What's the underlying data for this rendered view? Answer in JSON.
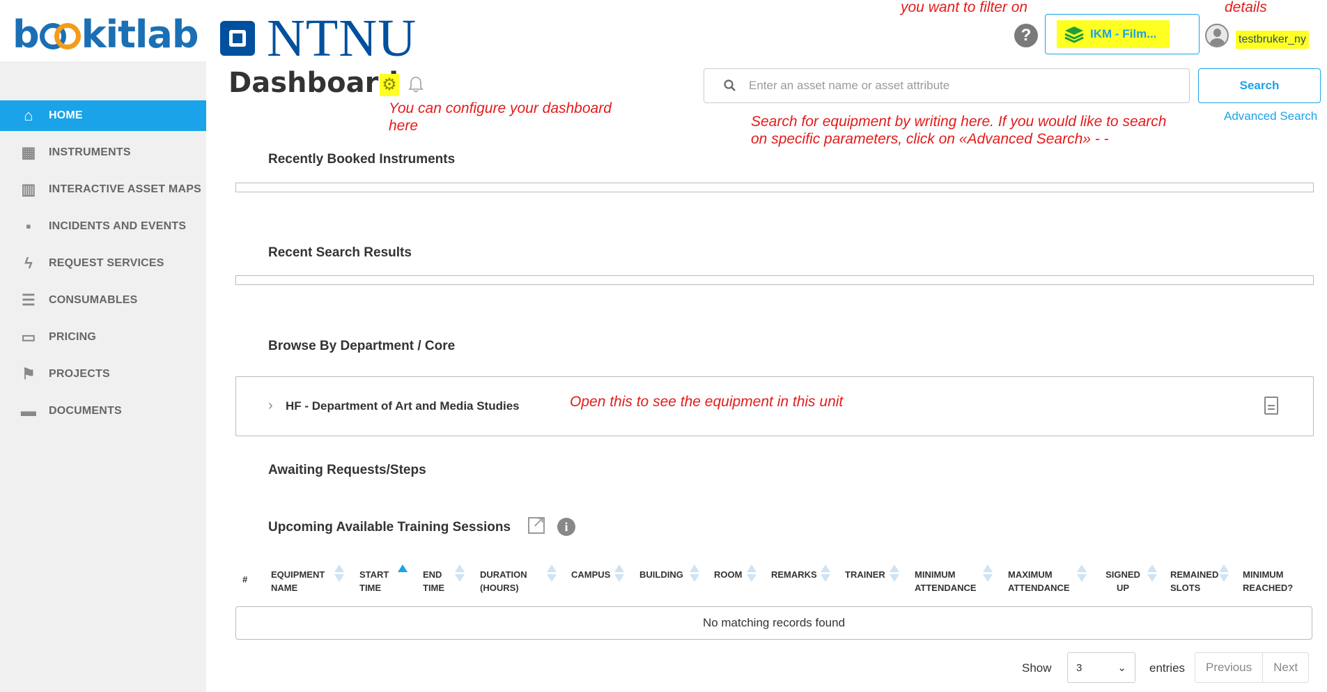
{
  "logo": {
    "text": "bookitlab"
  },
  "org": {
    "name": "NTNU"
  },
  "sidebar": {
    "items": [
      {
        "label": "HOME",
        "icon": "home-icon",
        "active": true
      },
      {
        "label": "INSTRUMENTS",
        "icon": "calendar-icon"
      },
      {
        "label": "INTERACTIVE ASSET MAPS",
        "icon": "map-icon"
      },
      {
        "label": "INCIDENTS AND EVENTS",
        "icon": "chat-icon"
      },
      {
        "label": "REQUEST SERVICES",
        "icon": "bolt-icon"
      },
      {
        "label": "CONSUMABLES",
        "icon": "list-icon"
      },
      {
        "label": "PRICING",
        "icon": "money-icon"
      },
      {
        "label": "PROJECTS",
        "icon": "flag-icon"
      },
      {
        "label": "DOCUMENTS",
        "icon": "folder-icon"
      }
    ]
  },
  "header": {
    "filter_label": "IKM - Film...",
    "user_name": "testbruker_ny"
  },
  "page": {
    "title": "Dashboard"
  },
  "search": {
    "placeholder": "Enter an asset name or asset attribute",
    "button": "Search",
    "advanced": "Advanced Search"
  },
  "sections": {
    "recently_booked": "Recently Booked Instruments",
    "recent_search": "Recent Search Results",
    "browse": "Browse By Department / Core",
    "awaiting": "Awaiting Requests/Steps",
    "training": "Upcoming Available Training Sessions"
  },
  "department": {
    "label": "HF - Department of Art and Media Studies"
  },
  "table": {
    "columns": [
      "#",
      "EQUIPMENT NAME",
      "START TIME",
      "END TIME",
      "DURATION (HOURS)",
      "CAMPUS",
      "BUILDING",
      "ROOM",
      "REMARKS",
      "TRAINER",
      "MINIMUM ATTENDANCE",
      "MAXIMUM ATTENDANCE",
      "SIGNED UP",
      "REMAINED SLOTS",
      "MINIMUM REACHED?"
    ],
    "empty": "No matching records found"
  },
  "pagination": {
    "show": "Show",
    "entries_value": "3",
    "entries": "entries",
    "previous": "Previous",
    "next": "Next"
  },
  "annotations": {
    "filter": "you want to filter on",
    "details": "details",
    "configure": "You can configure your dashboard here",
    "search": "Search for equipment by writing here. If you would like to search on specific parameters, click on «Advanced Search» - -",
    "department": "Open this to see the equipment in this unit"
  },
  "colors": {
    "accent": "#1aa3e8",
    "highlight": "#ffff22",
    "annotation": "#e31b1b",
    "ntnu": "#00509e",
    "sidebar_bg": "#f0f0f0"
  }
}
